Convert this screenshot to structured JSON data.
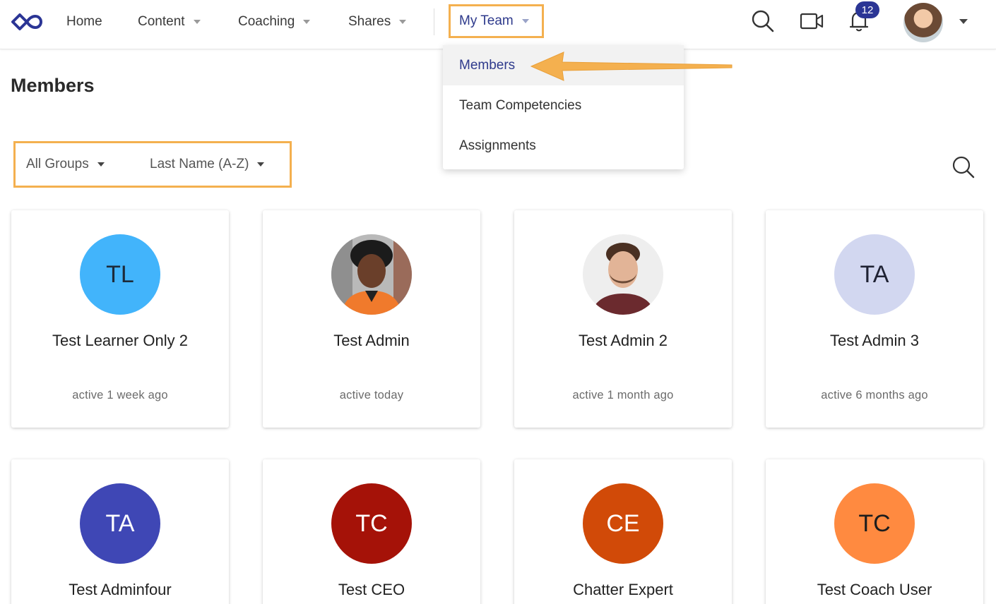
{
  "nav": {
    "items": [
      {
        "label": "Home",
        "has_caret": false
      },
      {
        "label": "Content",
        "has_caret": true
      },
      {
        "label": "Coaching",
        "has_caret": true
      },
      {
        "label": "Shares",
        "has_caret": true
      }
    ],
    "my_team_label": "My Team",
    "notification_count": "12",
    "highlight_color": "#f4b04f",
    "accent_color": "#2e3a8c"
  },
  "dropdown": {
    "items": [
      {
        "label": "Members",
        "active": true
      },
      {
        "label": "Team Competencies",
        "active": false
      },
      {
        "label": "Assignments",
        "active": false
      }
    ]
  },
  "page": {
    "title": "Members"
  },
  "filters": {
    "group": "All Groups",
    "sort": "Last Name (A-Z)"
  },
  "members": [
    {
      "initials": "TL",
      "name": "Test Learner Only 2",
      "status": "active 1 week ago",
      "bg": "#42b4fb",
      "fg": "#1d2b3a",
      "photo": false
    },
    {
      "initials": "",
      "name": "Test Admin",
      "status": "active today",
      "bg": "#d8d8d8",
      "fg": "#222",
      "photo": true
    },
    {
      "initials": "",
      "name": "Test Admin 2",
      "status": "active 1 month ago",
      "bg": "#ececec",
      "fg": "#222",
      "photo": true
    },
    {
      "initials": "TA",
      "name": "Test Admin 3",
      "status": "active 6 months ago",
      "bg": "#d2d7f0",
      "fg": "#1f2233",
      "photo": false
    },
    {
      "initials": "TA",
      "name": "Test Adminfour",
      "status": "",
      "bg": "#3f47b5",
      "fg": "#ffffff",
      "photo": false
    },
    {
      "initials": "TC",
      "name": "Test CEO",
      "status": "",
      "bg": "#a51208",
      "fg": "#ffffff",
      "photo": false
    },
    {
      "initials": "CE",
      "name": "Chatter Expert",
      "status": "",
      "bg": "#d14a08",
      "fg": "#ffffff",
      "photo": false
    },
    {
      "initials": "TC",
      "name": "Test Coach User",
      "status": "",
      "bg": "#ff8a40",
      "fg": "#1d1d1d",
      "photo": false
    }
  ]
}
